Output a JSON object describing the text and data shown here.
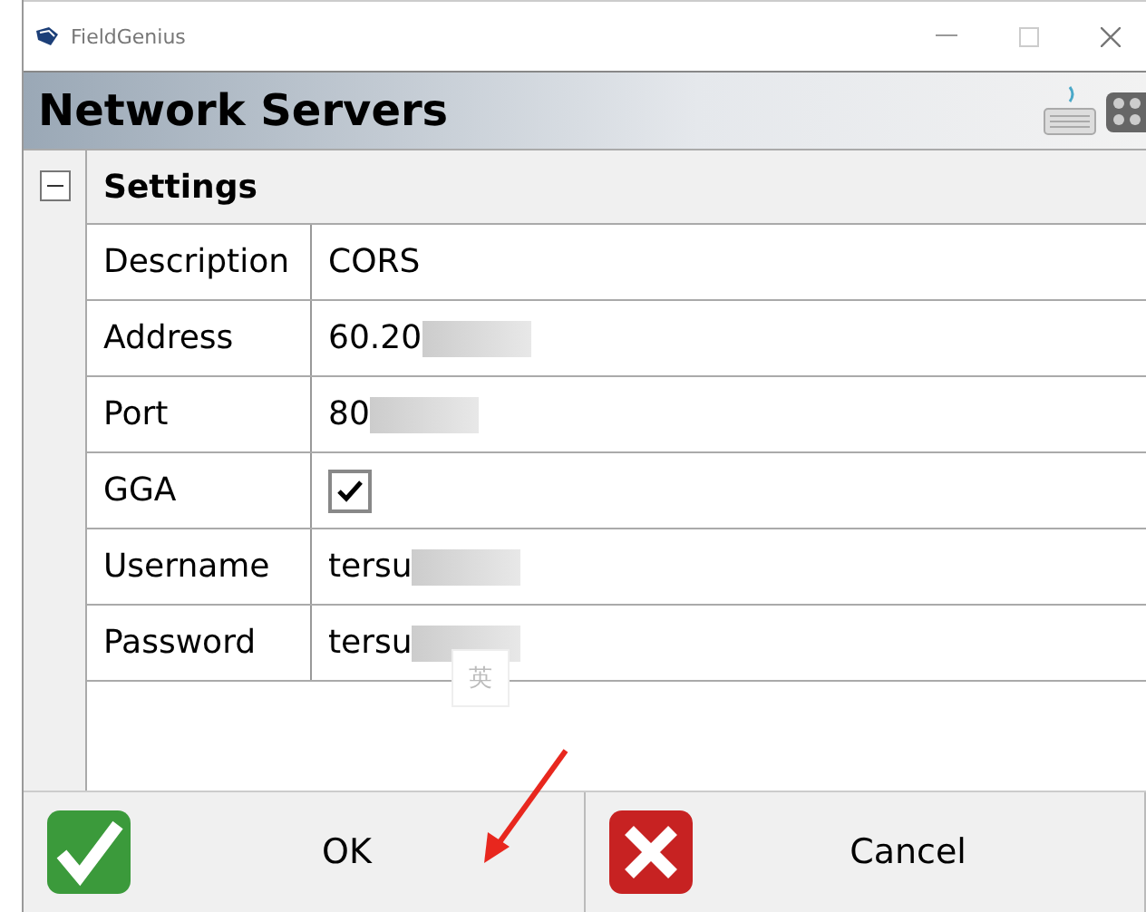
{
  "window": {
    "title": "FieldGenius"
  },
  "header": {
    "title": "Network Servers"
  },
  "section": {
    "title": "Settings",
    "expanded": true
  },
  "rows": [
    {
      "label": "Description",
      "kind": "text",
      "value": "CORS",
      "redacted": false
    },
    {
      "label": "Address",
      "kind": "text",
      "value": "60.20",
      "redacted": true
    },
    {
      "label": "Port",
      "kind": "text",
      "value": "80",
      "redacted": true
    },
    {
      "label": "GGA",
      "kind": "checkbox",
      "checked": true
    },
    {
      "label": "Username",
      "kind": "text",
      "value": "tersu",
      "redacted": true
    },
    {
      "label": "Password",
      "kind": "text",
      "value": "tersu",
      "redacted": true
    }
  ],
  "ime_indicator": "英",
  "buttons": [
    {
      "label": "OK",
      "kind": "ok"
    },
    {
      "label": "Cancel",
      "kind": "cancel"
    }
  ]
}
